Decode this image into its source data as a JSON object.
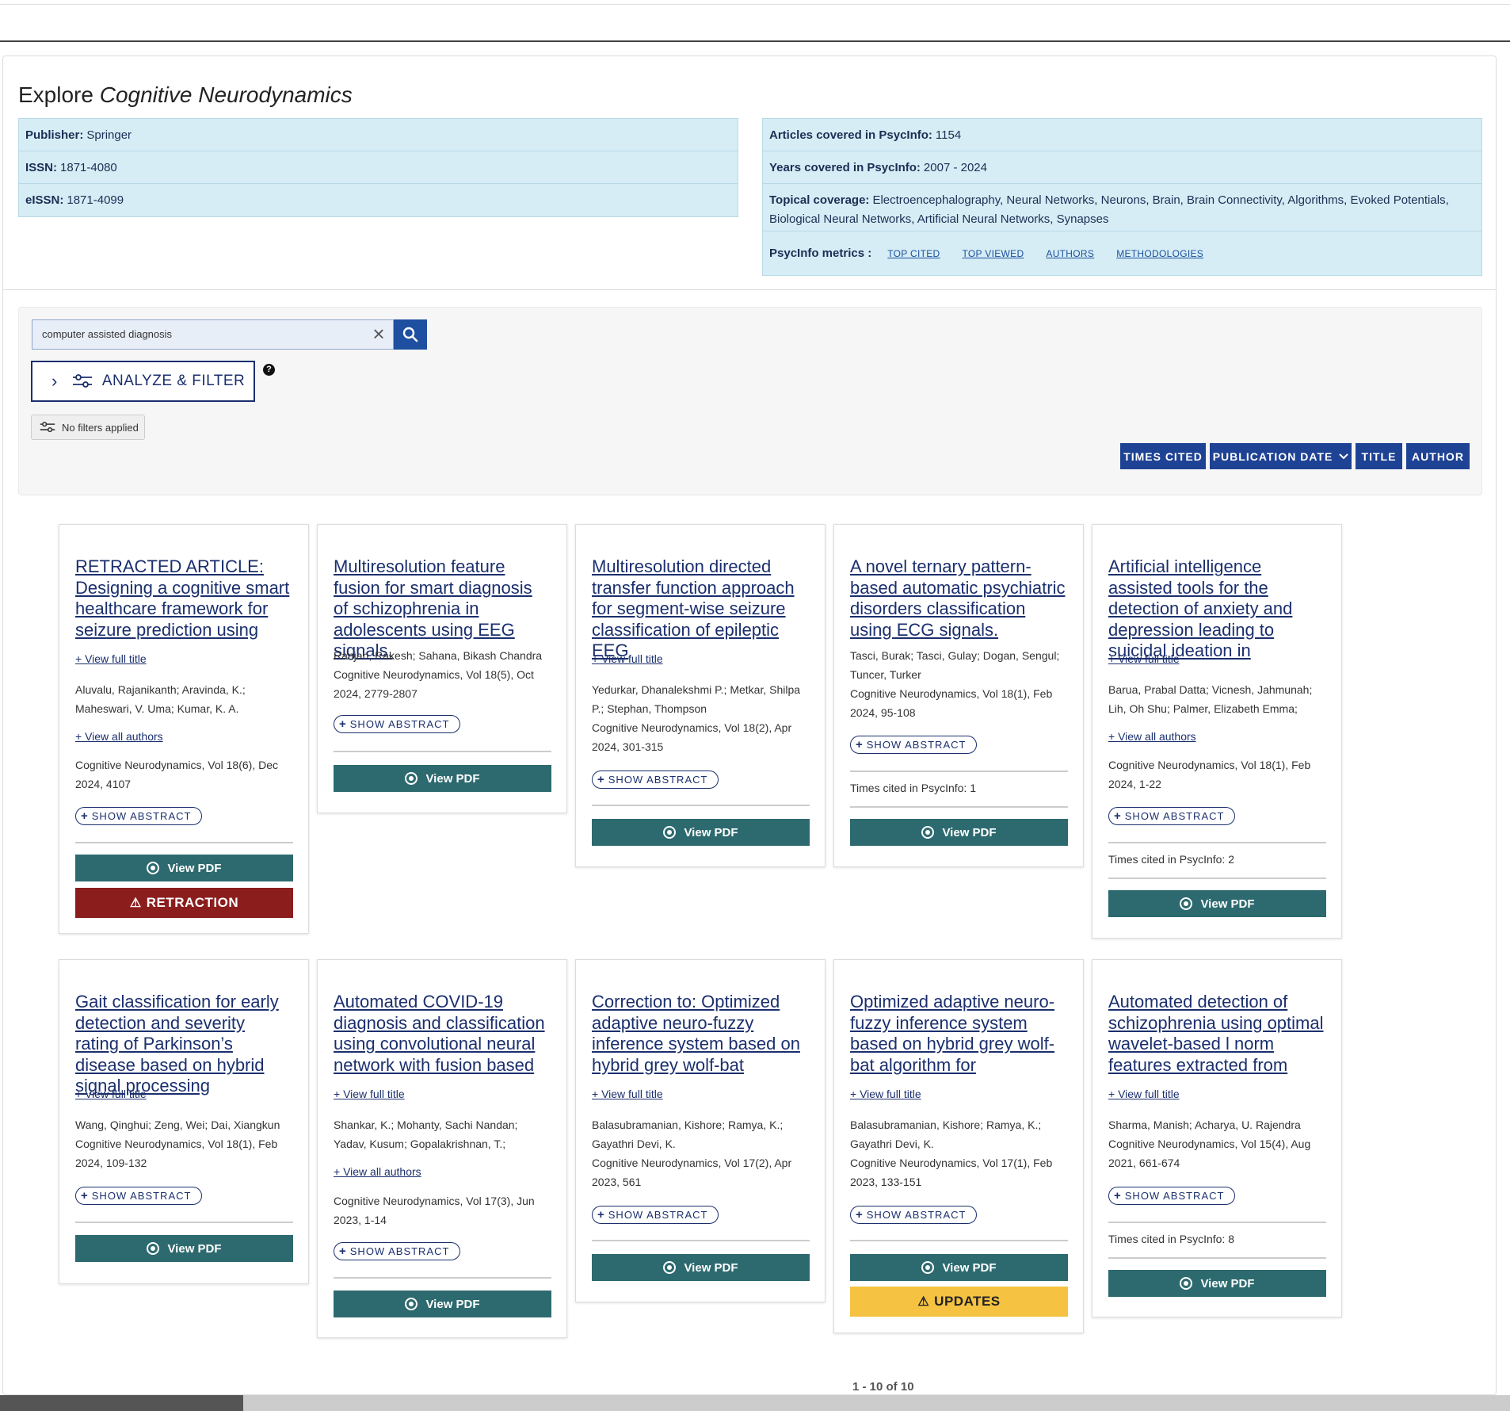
{
  "journal": {
    "explore_prefix": "Explore",
    "name": "Cognitive Neurodynamics",
    "publisher_label": "Publisher:",
    "publisher": "Springer",
    "issn_label": "ISSN:",
    "issn": "1871-4080",
    "eissn_label": "eISSN:",
    "eissn": "1871-4099",
    "articles_label": "Articles covered in PsycInfo:",
    "articles": "1154",
    "years_label": "Years covered in PsycInfo:",
    "years": "2007 - 2024",
    "topical_label": "Topical coverage:",
    "topical": "Electroencephalography, Neural Networks, Neurons, Brain, Brain Connectivity, Algorithms, Evoked Potentials, Biological Neural Networks, Artificial Neural Networks, Synapses",
    "metrics_label": "PsycInfo metrics :",
    "metrics_links": [
      "TOP CITED",
      "TOP VIEWED",
      "AUTHORS",
      "METHODOLOGIES"
    ]
  },
  "search": {
    "query": "computer assisted diagnosis",
    "analyze_label": "ANALYZE & FILTER",
    "help": "?",
    "no_filters": "No filters applied"
  },
  "sort": [
    "TIMES CITED",
    "PUBLICATION DATE",
    "TITLE",
    "AUTHOR"
  ],
  "labels": {
    "view_full_title": "+ View full title",
    "view_all_authors": "+ View all authors",
    "show_abstract": "SHOW ABSTRACT",
    "view_pdf": "View PDF",
    "retraction": "RETRACTION",
    "updates": "UPDATES"
  },
  "cards": [
    {
      "title": "RETRACTED ARTICLE: Designing a cognitive smart healthcare framework for seizure prediction using",
      "authors": "Aluvalu, Rajanikanth; Aravinda, K.; Maheswari, V. Uma; Kumar, K. A.",
      "source": "Cognitive Neurodynamics, Vol 18(6), Dec 2024, 4107"
    },
    {
      "title": "Multiresolution feature fusion for smart diagnosis of schizophrenia in adolescents using EEG signals.",
      "authors_source": "Ranjan, Rakesh; Sahana, Bikash Chandra\nCognitive Neurodynamics, Vol 18(5), Oct 2024, 2779-2807"
    },
    {
      "title": "Multiresolution directed transfer function approach for segment-wise seizure classification of epileptic EEG",
      "authors_source": "Yedurkar, Dhanalekshmi P.; Metkar, Shilpa P.; Stephan, Thompson\nCognitive Neurodynamics, Vol 18(2), Apr 2024, 301-315"
    },
    {
      "title": "A novel ternary pattern-based automatic psychiatric disorders classification using ECG signals.",
      "authors_source": "Tasci, Burak; Tasci, Gulay; Dogan, Sengul; Tuncer, Turker\nCognitive Neurodynamics, Vol 18(1), Feb 2024, 95-108",
      "cited": "Times cited in PsycInfo: 1"
    },
    {
      "title": "Artificial intelligence assisted tools for the detection of anxiety and depression leading to suicidal ideation in",
      "authors": "Barua, Prabal Datta; Vicnesh, Jahmunah; Lih, Oh Shu; Palmer, Elizabeth Emma;",
      "source": "Cognitive Neurodynamics, Vol 18(1), Feb 2024, 1-22",
      "cited": "Times cited in PsycInfo: 2"
    },
    {
      "title": "Gait classification for early detection and severity rating of Parkinson’s disease based on hybrid signal processing",
      "authors_source": "Wang, Qinghui; Zeng, Wei; Dai, Xiangkun\nCognitive Neurodynamics, Vol 18(1), Feb 2024, 109-132"
    },
    {
      "title": "Automated COVID-19 diagnosis and classification using convolutional neural network with fusion based",
      "authors": "Shankar, K.; Mohanty, Sachi Nandan; Yadav, Kusum; Gopalakrishnan, T.;",
      "source": "Cognitive Neurodynamics, Vol 17(3), Jun 2023, 1-14"
    },
    {
      "title": "Correction to: Optimized adaptive neuro-fuzzy inference system based on hybrid grey wolf-bat",
      "authors_source": "Balasubramanian, Kishore; Ramya, K.; Gayathri Devi, K.\nCognitive Neurodynamics, Vol 17(2), Apr 2023, 561"
    },
    {
      "title": "Optimized adaptive neuro-fuzzy inference system based on hybrid grey wolf-bat algorithm for",
      "authors_source": "Balasubramanian, Kishore; Ramya, K.; Gayathri Devi, K.\nCognitive Neurodynamics, Vol 17(1), Feb 2023, 133-151"
    },
    {
      "title": "Automated detection of schizophrenia using optimal wavelet-based l norm features extracted from",
      "authors_source": "Sharma, Manish; Acharya, U. Rajendra\nCognitive Neurodynamics, Vol 15(4), Aug 2021, 661-674",
      "cited": "Times cited in PsycInfo: 8"
    }
  ],
  "pagination": "1 - 10 of 10",
  "colors": {
    "info_bg": "#d6edf5",
    "primary": "#1e4294",
    "pdf": "#2d6a6f",
    "retraction": "#8b1d1d",
    "updates": "#f5c242",
    "link": "#1b2f6e"
  }
}
